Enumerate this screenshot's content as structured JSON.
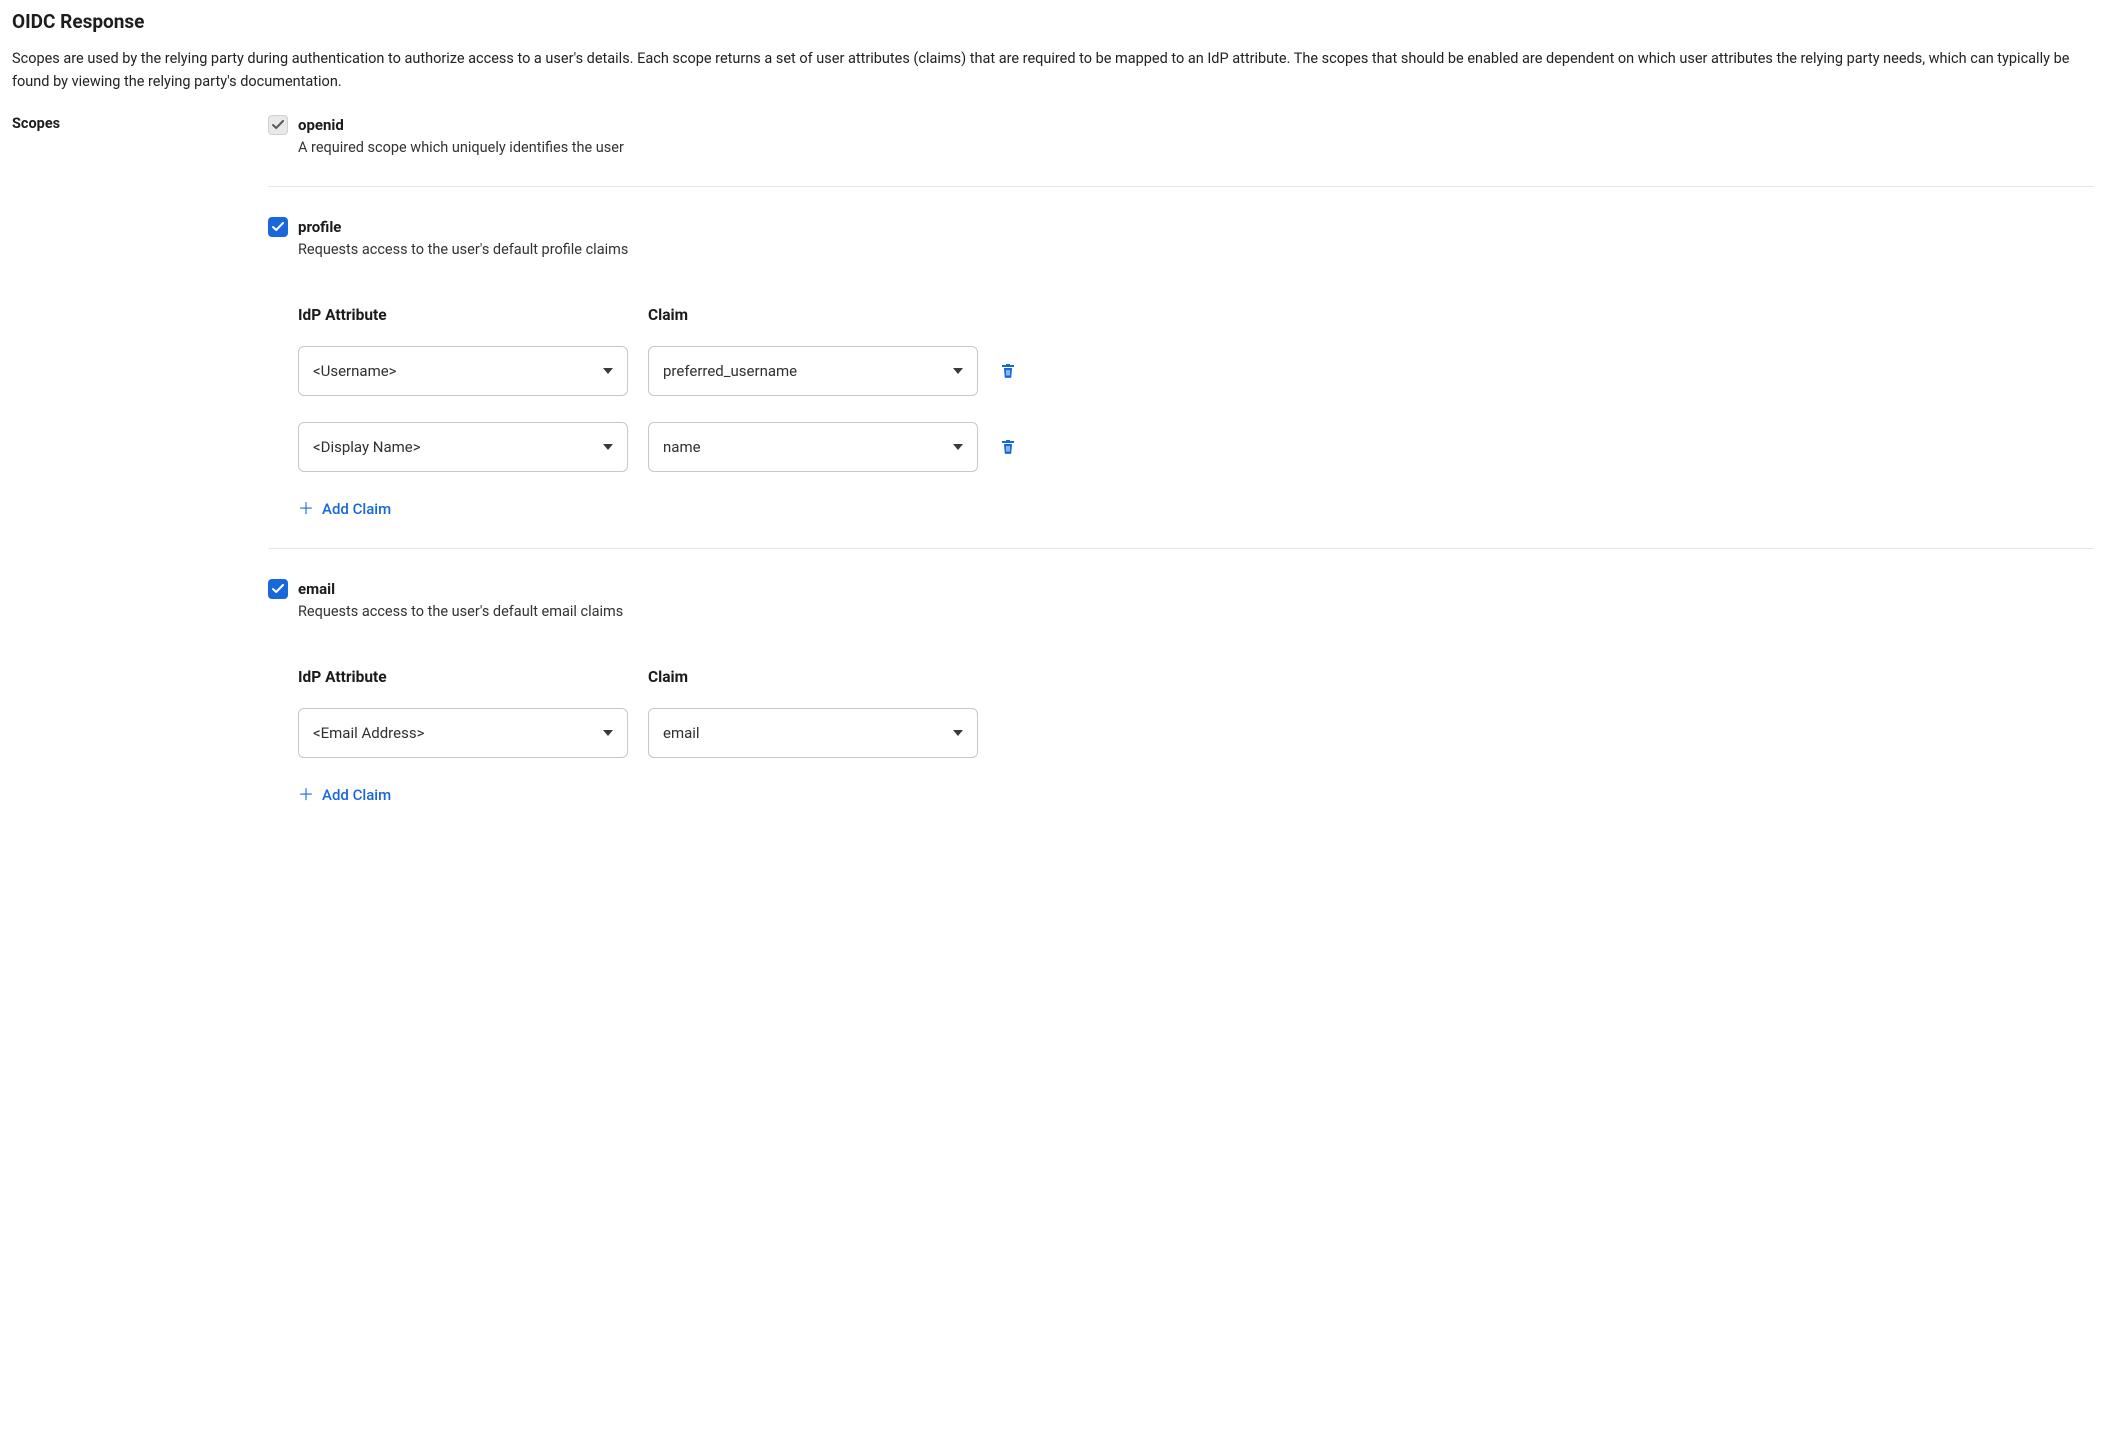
{
  "section": {
    "title": "OIDC Response",
    "description": "Scopes are used by the relying party during authentication to authorize access to a user's details. Each scope returns a set of user attributes (claims) that are required to be mapped to an IdP attribute. The scopes that should be enabled are dependent on which user attributes the relying party needs, which can typically be found by viewing the relying party's documentation."
  },
  "labels": {
    "scopes": "Scopes",
    "idp_attribute": "IdP Attribute",
    "claim": "Claim",
    "add_claim": "Add Claim"
  },
  "scopes": {
    "openid": {
      "name": "openid",
      "description": "A required scope which uniquely identifies the user",
      "checked": true,
      "disabled": true
    },
    "profile": {
      "name": "profile",
      "description": "Requests access to the user's default profile claims",
      "checked": true,
      "disabled": false,
      "claims": [
        {
          "idp_attribute": "<Username>",
          "claim": "preferred_username"
        },
        {
          "idp_attribute": "<Display Name>",
          "claim": "name"
        }
      ]
    },
    "email": {
      "name": "email",
      "description": "Requests access to the user's default email claims",
      "checked": true,
      "disabled": false,
      "claims": [
        {
          "idp_attribute": "<Email Address>",
          "claim": "email"
        }
      ]
    }
  }
}
